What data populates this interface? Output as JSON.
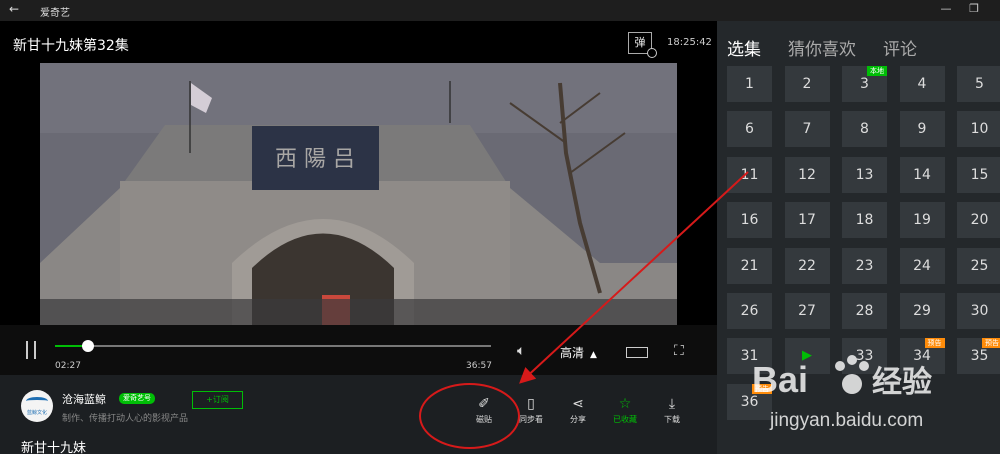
{
  "window": {
    "back_icon": "back-arrow-icon",
    "app_name": "爱奇艺",
    "minimize": "—",
    "maximize": "❐"
  },
  "player": {
    "title": "新甘十九妹第32集",
    "danmu_label": "弹",
    "clock": "18:25:42",
    "sign_text": "西 陽 吕",
    "progress": {
      "current": "02:27",
      "duration": "36:57",
      "played_fraction": 0.075
    },
    "quality_label": "高清",
    "quality_caret": "▲"
  },
  "channel": {
    "name": "沧海蓝鲸",
    "avatar_text": "蓝鲸文化",
    "badge": "爱奇艺号",
    "subscribe_label": "+订阅",
    "description": "制作、传播打动人心的影视产品"
  },
  "actions": [
    {
      "label": "磁贴",
      "icon": "pin-icon"
    },
    {
      "label": "同步看",
      "icon": "phone-icon"
    },
    {
      "label": "分享",
      "icon": "share-icon"
    },
    {
      "label": "已收藏",
      "icon": "star-icon"
    },
    {
      "label": "下载",
      "icon": "download-icon"
    }
  ],
  "show_title": "新甘十九妹",
  "panel": {
    "tabs": [
      "选集",
      "猜你喜欢",
      "评论"
    ],
    "active_tab": 0,
    "episodes": [
      {
        "n": "1"
      },
      {
        "n": "2"
      },
      {
        "n": "3",
        "badge": "本地"
      },
      {
        "n": "4"
      },
      {
        "n": "5"
      },
      {
        "n": "6"
      },
      {
        "n": "7"
      },
      {
        "n": "8"
      },
      {
        "n": "9"
      },
      {
        "n": "10"
      },
      {
        "n": "11"
      },
      {
        "n": "12"
      },
      {
        "n": "13"
      },
      {
        "n": "14"
      },
      {
        "n": "15"
      },
      {
        "n": "16"
      },
      {
        "n": "17"
      },
      {
        "n": "18"
      },
      {
        "n": "19"
      },
      {
        "n": "20"
      },
      {
        "n": "21"
      },
      {
        "n": "22"
      },
      {
        "n": "23"
      },
      {
        "n": "24"
      },
      {
        "n": "25"
      },
      {
        "n": "26"
      },
      {
        "n": "27"
      },
      {
        "n": "28"
      },
      {
        "n": "29"
      },
      {
        "n": "30"
      },
      {
        "n": "31"
      },
      {
        "n": "▶",
        "playing": true
      },
      {
        "n": "33"
      },
      {
        "n": "34",
        "badge": "预告"
      },
      {
        "n": "35",
        "badge": "预告"
      },
      {
        "n": "36",
        "badge": "预告"
      }
    ]
  },
  "watermark": {
    "brand": "Bai",
    "brand2": "经验",
    "url": "jingyan.baidu.com"
  },
  "colors": {
    "accent": "#00be06",
    "annotation": "#d61a1a",
    "badge_orange": "#ff8c0a"
  }
}
